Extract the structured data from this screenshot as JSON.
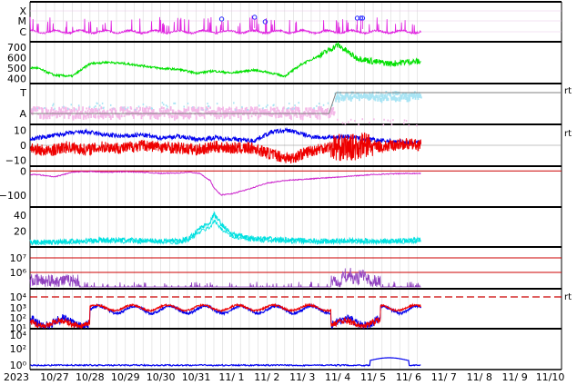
{
  "chart_data": [
    {
      "type": "line",
      "panel": "xray-flare-class",
      "ytick_labels": [
        "X",
        "M",
        "C"
      ],
      "flare_markers": 6,
      "color": "#e020e0",
      "grid": true
    },
    {
      "type": "line",
      "panel": "solar-wind-speed",
      "ytick_labels": [
        "700",
        "600",
        "500",
        "400"
      ],
      "ylim": [
        350,
        750
      ],
      "x": [
        0,
        0.5,
        1.0,
        1.5,
        2.0,
        2.5,
        3.0,
        3.5,
        4.0,
        4.5,
        5.0,
        5.5,
        5.9,
        6.1,
        6.5,
        7.0,
        7.5,
        8.0,
        8.5,
        9.0,
        9.5,
        10.0,
        10.5,
        10.85
      ],
      "values": [
        500,
        430,
        420,
        540,
        555,
        540,
        520,
        495,
        485,
        450,
        470,
        450,
        470,
        480,
        460,
        420,
        540,
        620,
        720,
        600,
        560,
        540,
        560,
        560
      ],
      "color": "#00e000",
      "grid": true
    },
    {
      "type": "scatter",
      "panel": "imf-sector",
      "ytick_labels": [
        "T",
        "A"
      ],
      "right_label": "rt",
      "colors": [
        "#f4b8e8",
        "#a8e4f4",
        "#808080"
      ],
      "grid": true
    },
    {
      "type": "line",
      "panel": "imf-components",
      "ytick_labels": [
        "10",
        "0",
        "−10"
      ],
      "ylim": [
        -14,
        14
      ],
      "series": [
        {
          "values": [
            4,
            6,
            8,
            9,
            7,
            6,
            7,
            5,
            6,
            4,
            5,
            4,
            3,
            9,
            10,
            6,
            5,
            6,
            4,
            3,
            2,
            2
          ]
        },
        {
          "values": [
            -2,
            -4,
            -1,
            -3,
            -1,
            -2,
            0,
            -1,
            -2,
            -3,
            -1,
            -2,
            -2,
            -6,
            -9,
            -4,
            -1,
            -2,
            0,
            -1,
            1,
            0
          ]
        }
      ],
      "series_colors": [
        "#0000ee",
        "#ee0000"
      ],
      "right_label": "rt",
      "grid": true
    },
    {
      "type": "line",
      "panel": "dst-index",
      "ytick_labels": [
        "0",
        "−100"
      ],
      "ylim": [
        -150,
        20
      ],
      "x": [
        0,
        0.5,
        1.0,
        1.5,
        2.0,
        2.5,
        3.0,
        3.5,
        4.0,
        4.3,
        4.6,
        4.9,
        5.0,
        5.2,
        5.5,
        6.0,
        6.5,
        7.0,
        7.5,
        8.0,
        8.5,
        9.0,
        9.5,
        10.0,
        10.5,
        10.85
      ],
      "values": [
        -15,
        -25,
        -5,
        -2,
        -5,
        -3,
        -5,
        -10,
        -8,
        -5,
        -10,
        -40,
        -70,
        -100,
        -95,
        -75,
        -50,
        -40,
        -35,
        -30,
        -25,
        -20,
        -15,
        -12,
        -10,
        -10
      ],
      "color": "#cc22cc",
      "grid": true
    },
    {
      "type": "line",
      "panel": "density",
      "ytick_labels": [
        "40",
        "20"
      ],
      "ylim": [
        0,
        50
      ],
      "x": [
        0,
        1,
        2,
        3,
        4,
        4.3,
        4.6,
        4.9,
        5.0,
        5.2,
        5.5,
        6.0,
        7.0,
        8.0,
        9.0,
        10.0,
        10.85
      ],
      "values": [
        5,
        6,
        8,
        7,
        6,
        10,
        22,
        30,
        40,
        28,
        15,
        10,
        8,
        6,
        7,
        6,
        8
      ],
      "color": "#00e0e0",
      "grid": true
    },
    {
      "type": "line",
      "panel": "proton-flux",
      "ytick_labels": [
        "10⁷",
        "10⁶"
      ],
      "color": "#9040c0",
      "grid": true
    },
    {
      "type": "line",
      "panel": "electron-flux",
      "ytick_labels": [
        "10⁴",
        "10³",
        "10²",
        "10¹"
      ],
      "series_colors": [
        "#0000ee",
        "#ee0000"
      ],
      "right_label": "rt",
      "grid": true
    },
    {
      "type": "line",
      "panel": "high-energy-flux",
      "ytick_labels": [
        "10⁴",
        "10²",
        "10⁰"
      ],
      "color": "#0000ee",
      "grid": true
    }
  ],
  "x_axis": {
    "year_label": "2023",
    "tick_labels": [
      "10/27",
      "10/28",
      "10/29",
      "10/30",
      "10/31",
      "11/ 1",
      "11/ 2",
      "11/ 3",
      "11/ 4",
      "11/ 5",
      "11/ 6",
      "11/ 7",
      "11/ 8",
      "11/ 9",
      "11/10"
    ]
  }
}
